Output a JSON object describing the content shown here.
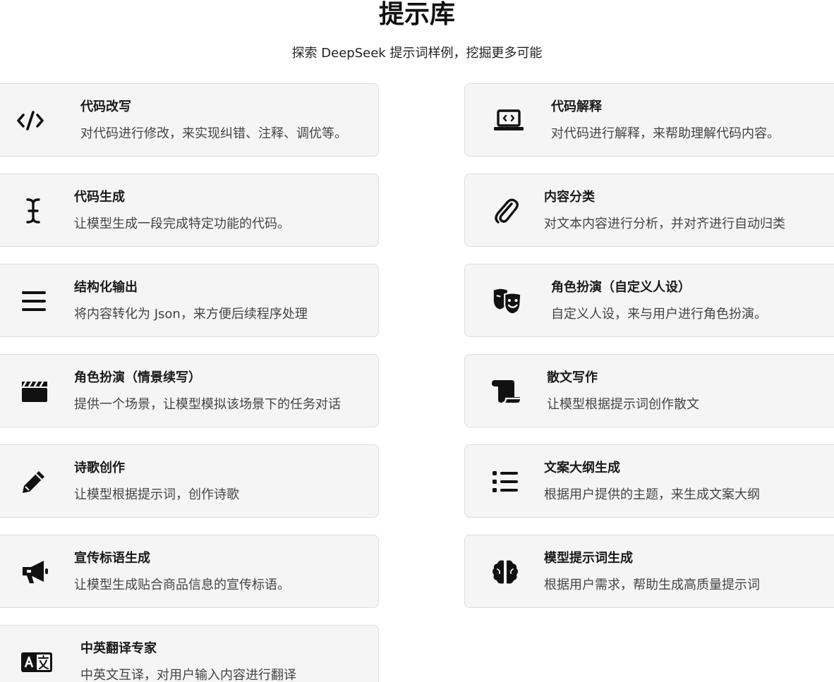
{
  "header": {
    "title": "提示库",
    "subtitle": "探索 DeepSeek 提示词样例，挖掘更多可能"
  },
  "cards": [
    {
      "icon": "code-icon",
      "title": "代码改写",
      "desc": "对代码进行修改，来实现纠错、注释、调优等。"
    },
    {
      "icon": "laptop-code-icon",
      "title": "代码解释",
      "desc": "对代码进行解释，来帮助理解代码内容。"
    },
    {
      "icon": "text-cursor-icon",
      "title": "代码生成",
      "desc": "让模型生成一段完成特定功能的代码。"
    },
    {
      "icon": "paperclip-icon",
      "title": "内容分类",
      "desc": "对文本内容进行分析，并对齐进行自动归类"
    },
    {
      "icon": "menu-lines-icon",
      "title": "结构化输出",
      "desc": "将内容转化为 Json，来方便后续程序处理"
    },
    {
      "icon": "theater-masks-icon",
      "title": "角色扮演（自定义人设）",
      "desc": "自定义人设，来与用户进行角色扮演。"
    },
    {
      "icon": "clapperboard-icon",
      "title": "角色扮演（情景续写）",
      "desc": "提供一个场景，让模型模拟该场景下的任务对话"
    },
    {
      "icon": "scroll-icon",
      "title": "散文写作",
      "desc": "让模型根据提示词创作散文"
    },
    {
      "icon": "pencil-icon",
      "title": "诗歌创作",
      "desc": "让模型根据提示词，创作诗歌"
    },
    {
      "icon": "list-icon",
      "title": "文案大纲生成",
      "desc": "根据用户提供的主题，来生成文案大纲"
    },
    {
      "icon": "megaphone-icon",
      "title": "宣传标语生成",
      "desc": "让模型生成贴合商品信息的宣传标语。"
    },
    {
      "icon": "brain-icon",
      "title": "模型提示词生成",
      "desc": "根据用户需求，帮助生成高质量提示词"
    },
    {
      "icon": "translate-icon",
      "title": "中英翻译专家",
      "desc": "中英文互译，对用户输入内容进行翻译"
    }
  ]
}
